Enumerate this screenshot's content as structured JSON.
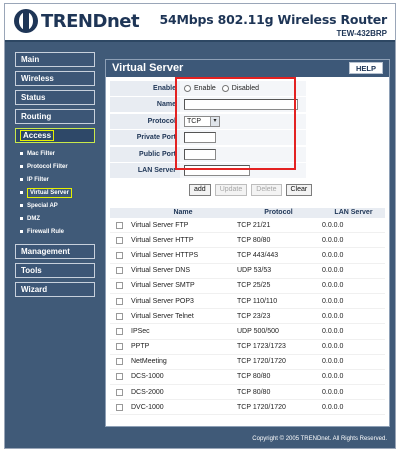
{
  "header": {
    "logo_text": "TRENDnet",
    "product_title": "54Mbps 802.11g Wireless Router",
    "model": "TEW-432BRP"
  },
  "sidebar": {
    "main": "Main",
    "wireless": "Wireless",
    "status": "Status",
    "routing": "Routing",
    "access": "Access",
    "access_items": [
      "Mac Filter",
      "Protocol Filter",
      "IP Filter",
      "Virtual Server",
      "Special AP",
      "DMZ",
      "Firewall Rule"
    ],
    "management": "Management",
    "tools": "Tools",
    "wizard": "Wizard"
  },
  "page": {
    "title": "Virtual Server",
    "help": "HELP"
  },
  "form": {
    "enable_label": "Enable",
    "enable_option": "Enable",
    "disabled_option": "Disabled",
    "name_label": "Name",
    "protocol_label": "Protocol",
    "protocol_value": "TCP",
    "private_port_label": "Private Port",
    "public_port_label": "Public Port",
    "lan_server_label": "LAN Server"
  },
  "buttons": {
    "add": "add",
    "update": "Update",
    "delete": "Delete",
    "clear": "Clear"
  },
  "table": {
    "headers": [
      "Name",
      "Protocol",
      "LAN Server"
    ],
    "rows": [
      {
        "name": "Virtual Server FTP",
        "protocol": "TCP 21/21",
        "lan": "0.0.0.0"
      },
      {
        "name": "Virtual Server HTTP",
        "protocol": "TCP 80/80",
        "lan": "0.0.0.0"
      },
      {
        "name": "Virtual Server HTTPS",
        "protocol": "TCP 443/443",
        "lan": "0.0.0.0"
      },
      {
        "name": "Virtual Server DNS",
        "protocol": "UDP 53/53",
        "lan": "0.0.0.0"
      },
      {
        "name": "Virtual Server SMTP",
        "protocol": "TCP 25/25",
        "lan": "0.0.0.0"
      },
      {
        "name": "Virtual Server POP3",
        "protocol": "TCP 110/110",
        "lan": "0.0.0.0"
      },
      {
        "name": "Virtual Server Telnet",
        "protocol": "TCP 23/23",
        "lan": "0.0.0.0"
      },
      {
        "name": "IPSec",
        "protocol": "UDP 500/500",
        "lan": "0.0.0.0"
      },
      {
        "name": "PPTP",
        "protocol": "TCP 1723/1723",
        "lan": "0.0.0.0"
      },
      {
        "name": "NetMeeting",
        "protocol": "TCP 1720/1720",
        "lan": "0.0.0.0"
      },
      {
        "name": "DCS-1000",
        "protocol": "TCP 80/80",
        "lan": "0.0.0.0"
      },
      {
        "name": "DCS-2000",
        "protocol": "TCP 80/80",
        "lan": "0.0.0.0"
      },
      {
        "name": "DVC-1000",
        "protocol": "TCP 1720/1720",
        "lan": "0.0.0.0"
      }
    ]
  },
  "footer": {
    "copyright": "Copyright © 2005 TRENDnet. All Rights Reserved."
  }
}
